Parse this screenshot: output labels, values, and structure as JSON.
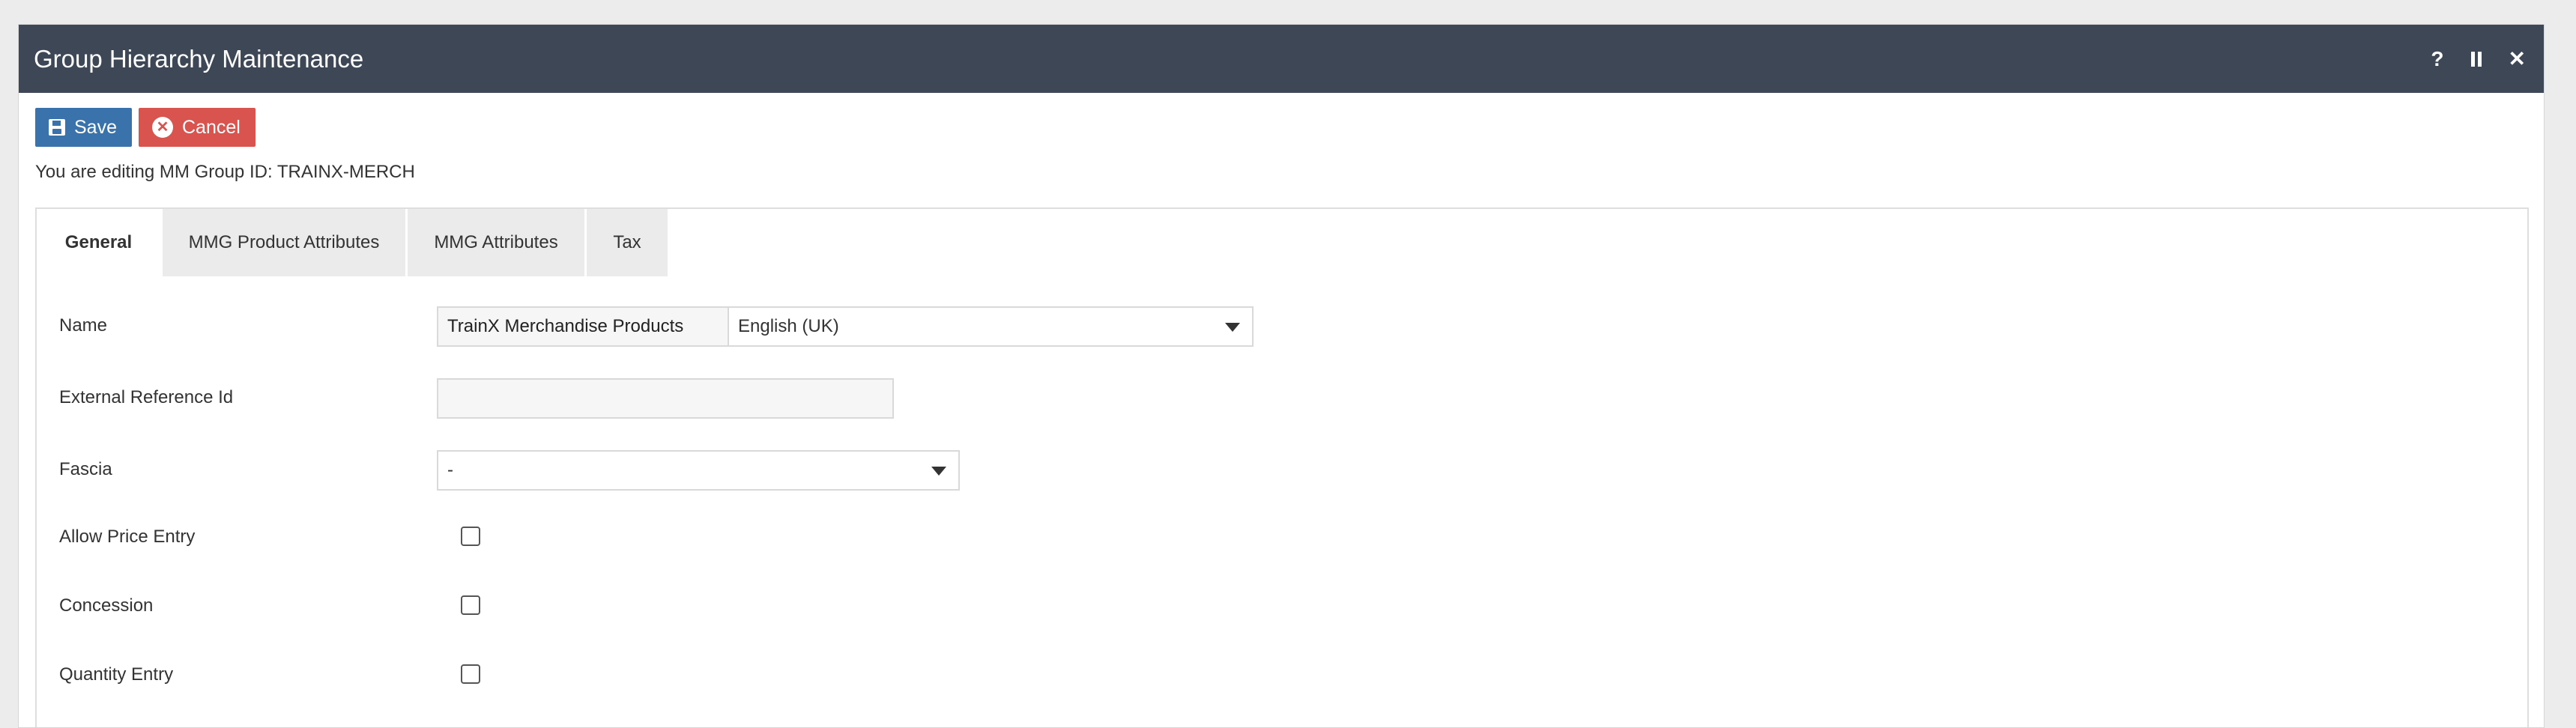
{
  "window": {
    "title": "Group Hierarchy Maintenance",
    "help_icon": "?",
    "pause_icon": "pause-icon",
    "close_icon": "✕"
  },
  "toolbar": {
    "save_label": "Save",
    "cancel_label": "Cancel"
  },
  "editing_text": "You are editing MM Group ID: TRAINX-MERCH",
  "tabs": [
    {
      "label": "General",
      "active": true
    },
    {
      "label": "MMG Product Attributes",
      "active": false
    },
    {
      "label": "MMG Attributes",
      "active": false
    },
    {
      "label": "Tax",
      "active": false
    }
  ],
  "form": {
    "name": {
      "label": "Name",
      "value": "TrainX Merchandise Products",
      "language": "English (UK)"
    },
    "external_ref": {
      "label": "External Reference Id",
      "value": ""
    },
    "fascia": {
      "label": "Fascia",
      "value": "-"
    },
    "allow_price_entry": {
      "label": "Allow Price Entry",
      "checked": false
    },
    "concession": {
      "label": "Concession",
      "checked": false
    },
    "quantity_entry": {
      "label": "Quantity Entry",
      "checked": false
    }
  },
  "colors": {
    "titlebar": "#3d4756",
    "save_button": "#3a73ab",
    "cancel_button": "#d9534f"
  }
}
